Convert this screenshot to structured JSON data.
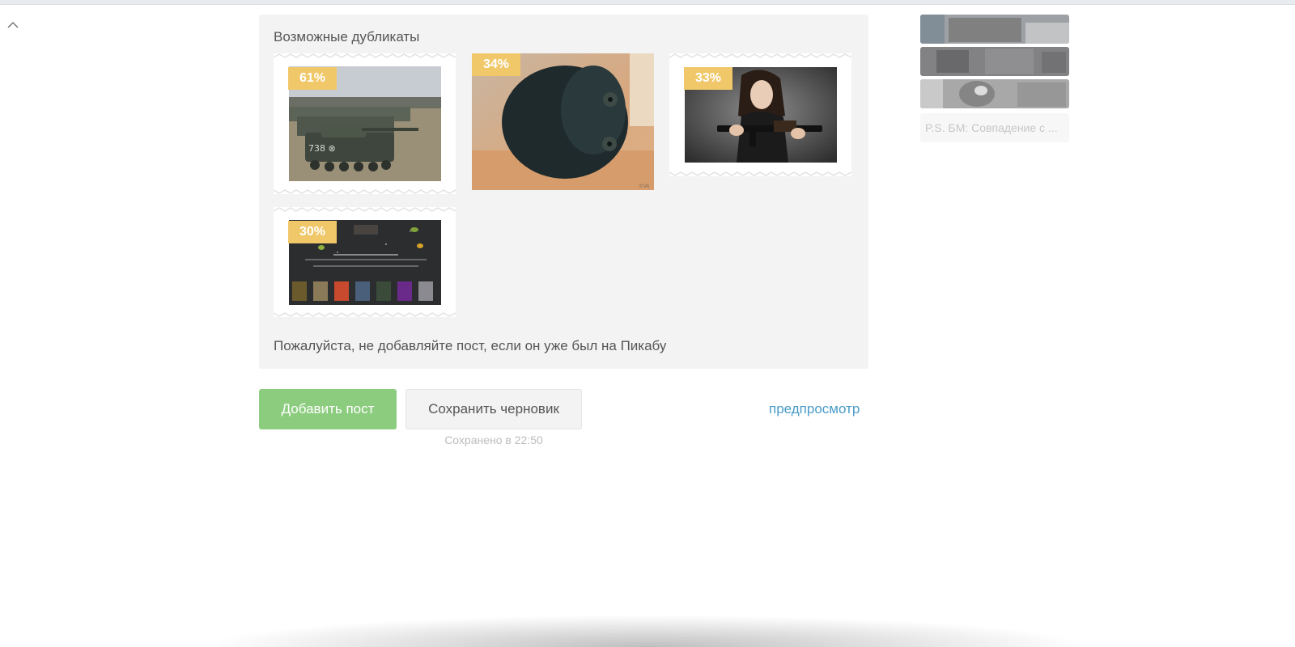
{
  "duplicates": {
    "title": "Возможные дубликаты",
    "items": [
      {
        "percent": "61%",
        "image": "tanks-row-photo"
      },
      {
        "percent": "34%",
        "image": "black-cat-photo"
      },
      {
        "percent": "33%",
        "image": "woman-with-rifle-photo"
      },
      {
        "percent": "30%",
        "image": "game-collection-banner"
      }
    ],
    "note": "Пожалуйста, не добавляйте пост, если он уже был на Пикабу"
  },
  "actions": {
    "add_label": "Добавить пост",
    "draft_label": "Сохранить черновик",
    "saved_status": "Сохранено в 22:50",
    "preview_label": "предпросмотр"
  },
  "sidebar": {
    "caption": "P.S. БМ: Совпадение с ..."
  },
  "colors": {
    "badge": "#f0c86a",
    "add_button": "#8ccc7e",
    "link": "#4a9bc7"
  }
}
